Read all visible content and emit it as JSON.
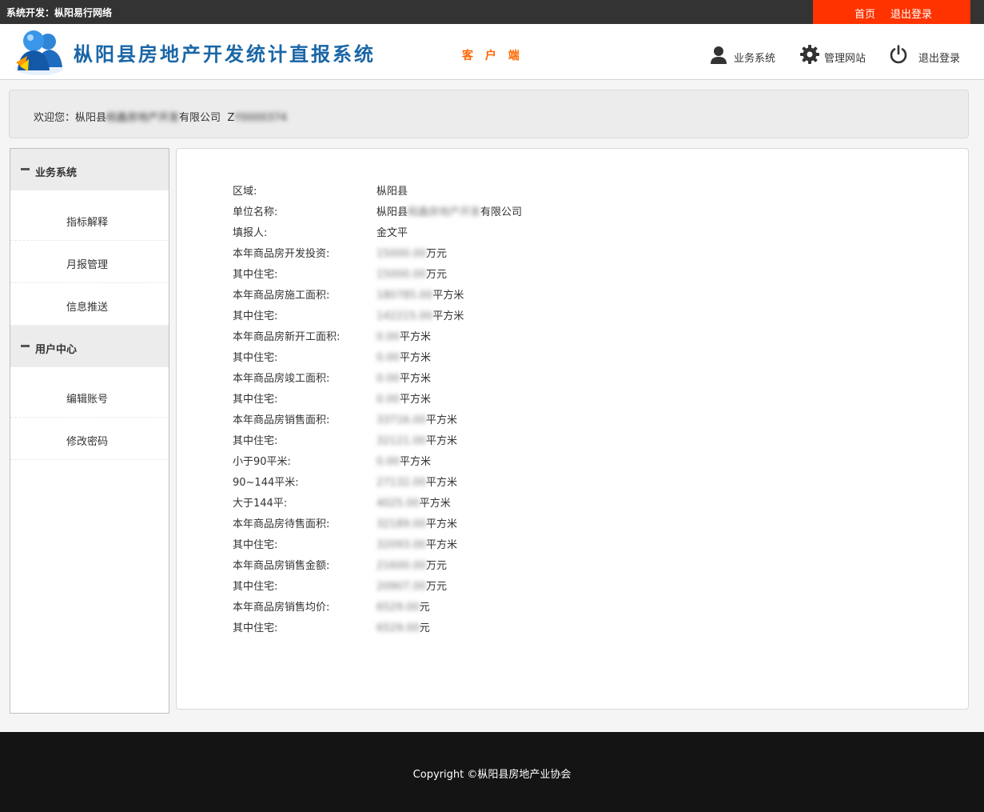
{
  "topbar": {
    "developer": "系统开发：枞阳易行网络",
    "home_link": "首页",
    "logout_link": "退出登录",
    "accent_color": "#ff3300"
  },
  "header": {
    "title": "枞阳县房地产开发统计直报系统",
    "client_label": "客 户 端",
    "nav": [
      {
        "icon": "user-icon",
        "label": "业务系统"
      },
      {
        "icon": "gear-icon",
        "label": "管理网站"
      },
      {
        "icon": "power-icon",
        "label": "退出登录"
      }
    ]
  },
  "welcome": {
    "prefix": "欢迎您：",
    "company_start": "枞阳县",
    "company_blurred": "皖鑫房地产开发",
    "company_end": "有限公司",
    "user_code_start": "Z",
    "user_code_blurred": "Y0000374"
  },
  "sidebar": {
    "sections": [
      {
        "title": "业务系统",
        "items": [
          "指标解释",
          "月报管理",
          "信息推送"
        ]
      },
      {
        "title": "用户中心",
        "items": [
          "编辑账号",
          "修改密码"
        ]
      }
    ]
  },
  "report": {
    "rows": [
      {
        "label": "区域:",
        "value": "枞阳县",
        "blurred": "",
        "unit": ""
      },
      {
        "label": "单位名称:",
        "value": "枞阳县",
        "blurred": "皖鑫房地产开发",
        "unit": "有限公司"
      },
      {
        "label": "填报人:",
        "value": "金文平",
        "blurred": "",
        "unit": ""
      },
      {
        "label": "本年商品房开发投资:",
        "value": "",
        "blurred": "15000.00",
        "unit": "万元"
      },
      {
        "label": "其中住宅:",
        "value": "",
        "blurred": "15000.00",
        "unit": "万元"
      },
      {
        "label": "本年商品房施工面积:",
        "value": "",
        "blurred": "180785.00",
        "unit": "平方米"
      },
      {
        "label": "其中住宅:",
        "value": "",
        "blurred": "142215.00",
        "unit": "平方米"
      },
      {
        "label": "本年商品房新开工面积:",
        "value": "",
        "blurred": "0.00",
        "unit": "平方米"
      },
      {
        "label": "其中住宅:",
        "value": "",
        "blurred": "0.00",
        "unit": "平方米"
      },
      {
        "label": "本年商品房竣工面积:",
        "value": "",
        "blurred": "0.00",
        "unit": "平方米"
      },
      {
        "label": "其中住宅:",
        "value": "",
        "blurred": "0.00",
        "unit": "平方米"
      },
      {
        "label": "本年商品房销售面积:",
        "value": "",
        "blurred": "33716.00",
        "unit": "平方米"
      },
      {
        "label": "其中住宅:",
        "value": "",
        "blurred": "32121.00",
        "unit": "平方米"
      },
      {
        "label": "小于90平米:",
        "value": "",
        "blurred": "0.00",
        "unit": "平方米"
      },
      {
        "label": "90~144平米:",
        "value": "",
        "blurred": "27132.00",
        "unit": "平方米"
      },
      {
        "label": "大于144平:",
        "value": "",
        "blurred": "4025.00",
        "unit": "平方米"
      },
      {
        "label": "本年商品房待售面积:",
        "value": "",
        "blurred": "32189.00",
        "unit": "平方米"
      },
      {
        "label": "其中住宅:",
        "value": "",
        "blurred": "32093.00",
        "unit": "平方米"
      },
      {
        "label": "本年商品房销售金额:",
        "value": "",
        "blurred": "21600.00",
        "unit": "万元"
      },
      {
        "label": "其中住宅:",
        "value": "",
        "blurred": "20907.00",
        "unit": "万元"
      },
      {
        "label": "本年商品房销售均价:",
        "value": "",
        "blurred": "6529.00",
        "unit": "元"
      },
      {
        "label": "其中住宅:",
        "value": "",
        "blurred": "6529.00",
        "unit": "元"
      }
    ]
  },
  "footer": {
    "copyright": "Copyright ©枞阳县房地产业协会"
  }
}
